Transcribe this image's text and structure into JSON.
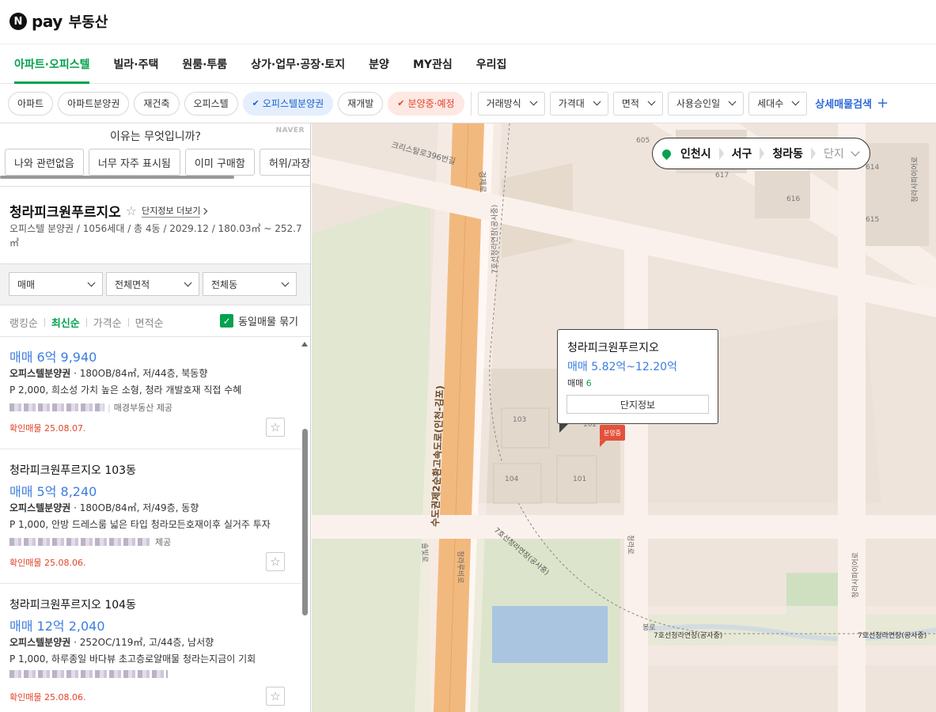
{
  "brand": {
    "n": "N",
    "pay": "pay",
    "name": "부동산"
  },
  "nav": {
    "tabs": [
      "아파트·오피스텔",
      "빌라·주택",
      "원룸·투룸",
      "상가·업무·공장·토지",
      "분양",
      "MY관심",
      "우리집"
    ],
    "active": 0
  },
  "filters": {
    "chips": [
      "아파트",
      "아파트분양권",
      "재건축",
      "오피스텔",
      "오피스텔분양권",
      "재개발",
      "분양중·예정"
    ],
    "selected_blue": "오피스텔분양권",
    "selected_red": "분양중·예정",
    "dropdowns": [
      "거래방식",
      "가격대",
      "면적",
      "사용승인일",
      "세대수"
    ],
    "advanced": "상세매물검색",
    "check_glyph": "✔",
    "plus": "+"
  },
  "survey": {
    "question": "이유는 무엇입니까?",
    "naver": "NAVER",
    "options": [
      "나와 관련없음",
      "너무 자주 표시됨",
      "이미 구매함",
      "허위/과장"
    ]
  },
  "complex": {
    "name": "청라피크원푸르지오",
    "star": "☆",
    "more": "단지정보 더보기",
    "info": "오피스텔 분양권 / 1056세대 / 총 4동 / 2029.12 / 180.03㎡ ~ 252.7㎡"
  },
  "selects": [
    "매매",
    "전체면적",
    "전체동"
  ],
  "sort": {
    "options": [
      "랭킹순",
      "최신순",
      "가격순",
      "면적순"
    ],
    "active": "최신순",
    "group_label": "동일매물 묶기",
    "check": "✓"
  },
  "listings": [
    {
      "name": "",
      "price": "매매 6억 9,940",
      "type": "오피스텔분양권",
      "spec": " · 180OB/84㎡, 저/44층, 북동향",
      "desc": "P 2,000, 희소성 가치 높은 소형, 청라 개발호재 직접 수혜",
      "agent": "매경부동산 제공",
      "badge": "확인매물 25.08.07.",
      "star": "☆"
    },
    {
      "name": "청라피크원푸르지오 103동",
      "price": "매매 5억 8,240",
      "type": "오피스텔분양권",
      "spec": " · 180OB/84㎡, 저/49층, 동향",
      "desc": "P 1,000, 안방 드레스룸 넓은 타입 청라모든호재이후 실거주 투자",
      "agent": "제공",
      "badge": "확인매물 25.08.06.",
      "star": "☆"
    },
    {
      "name": "청라피크원푸르지오 104동",
      "price": "매매 12억 2,040",
      "type": "오피스텔분양권",
      "spec": " · 252OC/119㎡, 고/44층, 남서향",
      "desc": "P 1,000, 하루종일 바다뷰 초고층로얄매물 청라는지금이 기회",
      "agent": "",
      "badge": "확인매물 25.08.06.",
      "star": "☆"
    }
  ],
  "map": {
    "location": [
      "인천시",
      "서구",
      "청라동",
      "단지"
    ],
    "popup": {
      "title": "청라피크원푸르지오",
      "price": "매매 5.82억~12.20억",
      "count_label": "매매",
      "count": "6",
      "button": "단지정보"
    },
    "marker": "분양중",
    "labels": {
      "highway": "수도권제2순환고속도로(인천-김포)",
      "rail1": "7호선청라연장(공사중)",
      "rail2": "7호선청라연장(공사중)",
      "rail3": "7호선청라연장(공사중)",
      "rail4": "7호선청라연장(공사중)",
      "road1": "청라사파이어로",
      "road2": "청라사파이어로",
      "road3": "경제로",
      "road4": "솔빛로",
      "road5": "청라루비로",
      "road6": "청라로",
      "road7": "봉로",
      "road8": "크리스탈로396번길",
      "b605": "605",
      "b617": "617",
      "b616": "616",
      "b615": "615",
      "b614": "614",
      "b103": "103",
      "b104": "104",
      "b101": "101",
      "b102": "102"
    }
  }
}
